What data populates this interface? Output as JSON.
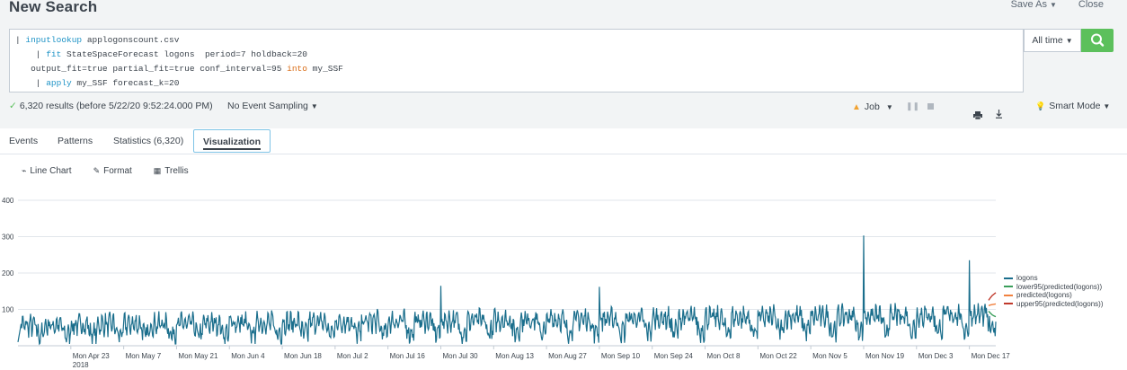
{
  "header": {
    "title": "New Search",
    "save_as": "Save As",
    "close": "Close"
  },
  "search": {
    "lines": [
      [
        {
          "t": "| "
        },
        {
          "t": "inputlookup",
          "c": "kw"
        },
        {
          "t": " applogonscount.csv"
        }
      ],
      [
        {
          "t": "    | "
        },
        {
          "t": "fit",
          "c": "kw"
        },
        {
          "t": " StateSpaceForecast logons  period=7 holdback=20"
        }
      ],
      [
        {
          "t": "   output_fit=true partial_fit=true conf_interval=95 "
        },
        {
          "t": "into",
          "c": "kw2"
        },
        {
          "t": " my_SSF"
        }
      ],
      [
        {
          "t": "    | "
        },
        {
          "t": "apply",
          "c": "kw"
        },
        {
          "t": " my_SSF forecast_k=20"
        }
      ]
    ],
    "time_range": "All time"
  },
  "status": {
    "results": "6,320 results (before 5/22/20 9:52:24.000 PM)",
    "sampling": "No Event Sampling",
    "job": "Job",
    "mode": "Smart Mode"
  },
  "tabs": [
    {
      "label": "Events",
      "active": false
    },
    {
      "label": "Patterns",
      "active": false
    },
    {
      "label": "Statistics (6,320)",
      "active": false
    },
    {
      "label": "Visualization",
      "active": true
    }
  ],
  "viz_toolbar": {
    "chart_type": "Line Chart",
    "format": "Format",
    "trellis": "Trellis"
  },
  "chart_data": {
    "type": "line",
    "title": "",
    "xlabel": "",
    "ylabel": "",
    "ylim": [
      0,
      400
    ],
    "y_ticks": [
      100,
      200,
      300,
      400
    ],
    "y_tick_labels": [
      "100",
      "200",
      "300",
      "400"
    ],
    "x_ticks": [
      "Mon Apr 23\n2018",
      "Mon May 7",
      "Mon May 21",
      "Mon Jun 4",
      "Mon Jun 18",
      "Mon Jul 2",
      "Mon Jul 16",
      "Mon Jul 30",
      "Mon Aug 13",
      "Mon Aug 27",
      "Mon Sep 10",
      "Mon Sep 24",
      "Mon Oct 8",
      "Mon Oct 22",
      "Mon Nov 5",
      "Mon Nov 19",
      "Mon Dec 3",
      "Mon Dec 17"
    ],
    "x_tick_labels": [
      "Mon Apr 23",
      "Mon May 7",
      "Mon May 21",
      "Mon Jun 4",
      "Mon Jun 18",
      "Mon Jul 2",
      "Mon Jul 16",
      "Mon Jul 30",
      "Mon Aug 13",
      "Mon Aug 27",
      "Mon Sep 10",
      "Mon Sep 24",
      "Mon Oct 8",
      "Mon Oct 22",
      "Mon Nov 5",
      "Mon Nov 19",
      "Mon Dec 3",
      "Mon Dec 17"
    ],
    "x_sub_label": "2018",
    "series": [
      {
        "name": "logons",
        "color": "#1a6e8c",
        "x_start": "2018-04-09",
        "interval_hours": 1,
        "weekly_pattern_note": "hourly values, weekly cycles",
        "approx_daily_range": [
          30,
          130
        ],
        "peaks": [
          {
            "x": "Mon Nov 19",
            "y": 303
          },
          {
            "x": "Mon Dec 17",
            "y": 235
          },
          {
            "x": "Mon Jul 30",
            "y": 165
          },
          {
            "x": "Mon Sep 10",
            "y": 162
          }
        ],
        "last_x": "2018-12-24"
      },
      {
        "name": "lower95(predicted(logons))",
        "color": "#3a9e5a"
      },
      {
        "name": "predicted(logons)",
        "color": "#f1813f"
      },
      {
        "name": "upper95(predicted(logons))",
        "color": "#c0392b"
      }
    ],
    "legend_position": "right",
    "grid": true
  }
}
